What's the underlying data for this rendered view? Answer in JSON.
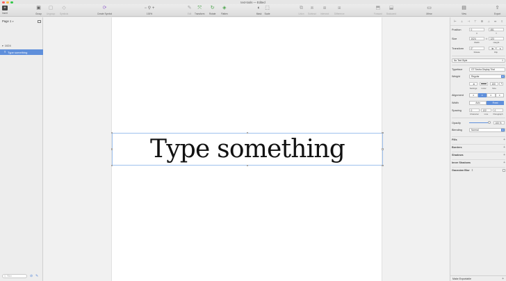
{
  "window": {
    "title": "text-tools — Edited"
  },
  "toolbar": {
    "insert": "Insert",
    "group": "Group",
    "ungroup": "Ungroup",
    "symbols": "Symbols",
    "create_symbol": "Create Symbol",
    "zoom": "100%",
    "edit": "Edit",
    "transform": "Transform",
    "rotate": "Rotate",
    "flatten": "Flatten",
    "mask": "Mask",
    "scale": "Scale",
    "union": "Union",
    "subtract": "Subtract",
    "intersect": "Intersect",
    "difference": "Difference",
    "forward": "Forward",
    "backward": "Backward",
    "mirror": "Mirror",
    "view": "View",
    "export": "Export"
  },
  "sidebar": {
    "page": "Page 1",
    "artboard": "1024",
    "layer": "Type something",
    "layer_icon": "T",
    "search_placeholder": "Filter"
  },
  "canvas": {
    "text": "Type something"
  },
  "inspector": {
    "position_label": "Position",
    "x": "0",
    "y": "451",
    "x_sub": "X",
    "y_sub": "Y",
    "size_label": "Size",
    "width": "1024",
    "height": "123",
    "w_sub": "Width",
    "h_sub": "Height",
    "transform_label": "Transform",
    "rotate": "0°",
    "rotate_sub": "Rotate",
    "flip_sub": "Flip",
    "text_style": "No Text Style",
    "typeface_label": "Typeface",
    "typeface": "GT Sectra Display Trial",
    "weight_label": "Weight",
    "weight": "Regular",
    "size_value": "100",
    "settings_sub": "Settings",
    "color_sub": "Color",
    "size_sub": "Size",
    "alignment_label": "Alignment",
    "width_label": "Width",
    "auto": "Auto",
    "fixed": "Fixed",
    "spacing_label": "Spacing",
    "character": "0",
    "line": "122",
    "paragraph": "0",
    "character_sub": "Character",
    "line_sub": "Line",
    "paragraph_sub": "Paragraph",
    "opacity_label": "Opacity",
    "opacity": "100 %",
    "opacity_level": 100,
    "blending_label": "Blending",
    "blending": "Normal",
    "fills": "Fills",
    "borders": "Borders",
    "shadows": "Shadows",
    "inner_shadows": "Inner Shadows",
    "gaussian_blur": "Gaussian Blur",
    "make_exportable": "Make Exportable"
  },
  "colors": {
    "accent": "#5f8fdb",
    "text": "#111111"
  }
}
